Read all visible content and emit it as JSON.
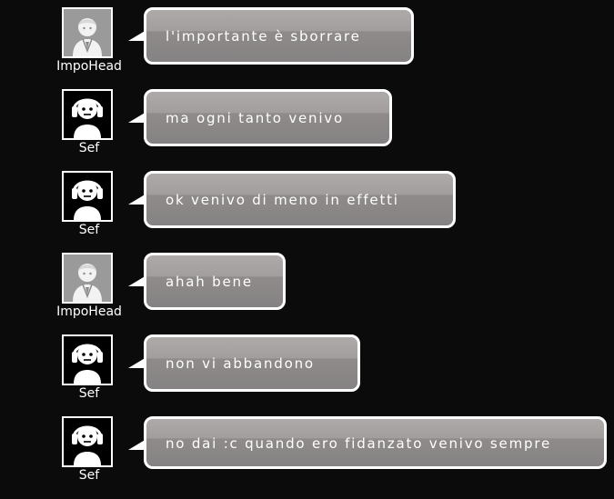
{
  "messages": [
    {
      "user": "ImpoHead",
      "avatar": "impohead-avatar",
      "text": "l'importante è sborrare"
    },
    {
      "user": "Sef",
      "avatar": "headphones-avatar",
      "text": "ma ogni tanto venivo"
    },
    {
      "user": "Sef",
      "avatar": "headphones-avatar",
      "text": "ok venivo di meno in effetti"
    },
    {
      "user": "ImpoHead",
      "avatar": "impohead-avatar",
      "text": "ahah bene"
    },
    {
      "user": "Sef",
      "avatar": "headphones-avatar",
      "text": "non vi abbandono"
    },
    {
      "user": "Sef",
      "avatar": "headphones-avatar",
      "text": "no dai :c quando ero fidanzato venivo sempre"
    }
  ],
  "colors": {
    "background": "#0b0b0b",
    "bubble_top": "#aeaaa9",
    "bubble_bottom": "#858283",
    "text": "#ffffff"
  }
}
